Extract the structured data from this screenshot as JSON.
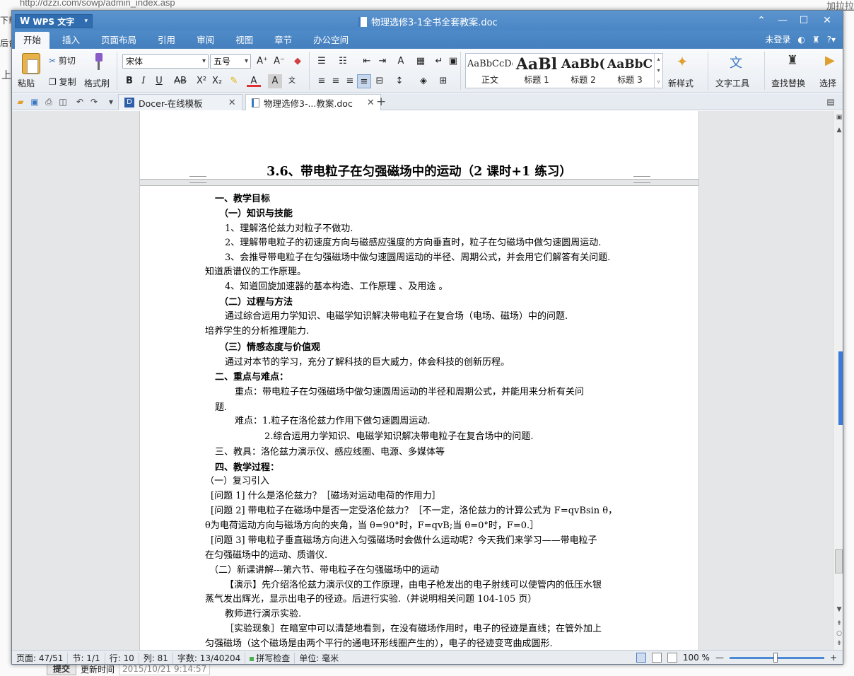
{
  "background": {
    "url": "http://dzzi.com/sowp/admin_index.asp",
    "left_text_1": "下载",
    "left_text_2": "后台",
    "left_text_3": "上",
    "right_link": "加拉拉",
    "submit_label": "提交",
    "update_label": "更新时间",
    "update_time": "2015/10/21 9:14:57"
  },
  "window": {
    "app_name": "WPS 文字",
    "doc_title": "物理选修3-1全书全套教案.doc",
    "controls": {
      "collapse": "⌃",
      "minimize": "—",
      "maximize": "☐",
      "close": "✕"
    }
  },
  "menu": {
    "tabs": [
      "开始",
      "插入",
      "页面布局",
      "引用",
      "审阅",
      "视图",
      "章节",
      "办公空间"
    ],
    "active": "开始",
    "login": "未登录"
  },
  "ribbon": {
    "paste": "粘贴",
    "cut": "剪切",
    "copy": "复制",
    "format_painter": "格式刷",
    "font_name": "宋体",
    "font_size": "五号",
    "grow": "A⁺",
    "shrink": "A⁻",
    "bold": "B",
    "italic": "I",
    "underline": "U",
    "strike": "AB",
    "superscript": "X²",
    "subscript": "X₂",
    "styles": [
      {
        "sample": "AaBbCcDd",
        "name": "正文"
      },
      {
        "sample": "AaBl",
        "name": "标题 1"
      },
      {
        "sample": "AaBb(",
        "name": "标题 2"
      },
      {
        "sample": "AaBbC",
        "name": "标题 3"
      }
    ],
    "new_style": "新样式",
    "text_tools": "文字工具",
    "find_replace": "查找替换",
    "select": "选择"
  },
  "tabs": [
    {
      "label": "Docer-在线模板",
      "close": "✕"
    },
    {
      "label": "物理选修3-...教案.doc",
      "close": "✕"
    }
  ],
  "tab_add": "+",
  "document": {
    "heading": "3.6、带电粒子在匀强磁场中的运动（2 课时+1 练习）",
    "lines": [
      {
        "text": "一、教学目标",
        "bold": true
      },
      {
        "text": "（一）知识与技能",
        "bold": true
      },
      {
        "text": "1、理解洛伦兹力对粒子不做功.",
        "bold": false
      },
      {
        "text": "2、理解带电粒子的初速度方向与磁感应强度的方向垂直时，粒子在匀磁场中做匀速圆周运动.",
        "bold": false
      },
      {
        "text": "3、会推导带电粒子在匀强磁场中做匀速圆周运动的半径、周期公式，并会用它们解答有关问题.",
        "bold": false
      },
      {
        "text": "知道质谱仪的工作原理。",
        "bold": false
      },
      {
        "text": "4、知道回旋加速器的基本构造、工作原理 、及用途 。",
        "bold": false
      },
      {
        "text": "（二）过程与方法",
        "bold": true
      },
      {
        "text": "通过综合运用力学知识、电磁学知识解决带电粒子在复合场（电场、磁场）中的问题.",
        "bold": false
      },
      {
        "text": "培养学生的分析推理能力.",
        "bold": false
      },
      {
        "text": "（三）情感态度与价值观",
        "bold": true
      },
      {
        "text": "通过对本节的学习，充分了解科技的巨大威力，体会科技的创新历程。",
        "bold": false
      },
      {
        "text": "二、重点与难点：",
        "bold": true
      },
      {
        "text": "重点：带电粒子在匀强磁场中做匀速圆周运动的半径和周期公式，并能用来分析有关问",
        "bold": false
      },
      {
        "text": "题.",
        "bold": false
      },
      {
        "text": "难点：1.粒子在洛伦兹力作用下做匀速圆周运动.",
        "bold": false
      },
      {
        "text": "2.综合运用力学知识、电磁学知识解决带电粒子在复合场中的问题.",
        "bold": false
      },
      {
        "text": "三、教具：洛伦兹力演示仪、感应线圈、电源、多媒体等",
        "bold": false
      },
      {
        "text": "四、教学过程：",
        "bold": true
      },
      {
        "text": "（一）复习引入",
        "bold": false
      },
      {
        "text": "[问题 1] 什么是洛伦兹力？［磁场对运动电荷的作用力］",
        "bold": false
      },
      {
        "text": "[问题 2] 带电粒子在磁场中是否一定受洛伦兹力？［不一定，洛伦兹力的计算公式为 F=qvBsin θ，",
        "bold": false
      },
      {
        "text": "θ为电荷运动方向与磁场方向的夹角，当 θ=90°时，F=qvB;当 θ=0°时，F=0.］",
        "bold": false
      },
      {
        "text": "[问题 3] 带电粒子垂直磁场方向进入匀强磁场时会做什么运动呢？今天我们来学习——带电粒子",
        "bold": false
      },
      {
        "text": "在匀强磁场中的运动、质谱仪.",
        "bold": false
      },
      {
        "text": "（二）新课讲解---第六节、带电粒子在匀强磁场中的运动",
        "bold": false
      },
      {
        "text": "【演示】先介绍洛伦兹力演示仪的工作原理，由电子枪发出的电子射线可以使管内的低压水银",
        "bold": false
      },
      {
        "text": "蒸气发出辉光，显示出电子的径迹。后进行实验.（并说明相关问题 104-105 页）",
        "bold": false
      },
      {
        "text": "教师进行演示实验.",
        "bold": false
      },
      {
        "text": "［实验现象］在暗室中可以清楚地看到，在没有磁场作用时，电子的径迹是直线；在管外加上",
        "bold": false
      },
      {
        "text": "匀强磁场（这个磁场是由两个平行的通电环形线圈产生的），电子的径迹变弯曲成圆形.",
        "bold": false
      }
    ]
  },
  "status": {
    "page": "页面: 47/51",
    "section": "节: 1/1",
    "row": "行: 10",
    "col": "列: 81",
    "words": "字数: 13/40204",
    "spell": "拼写检查",
    "unit": "单位: 毫米",
    "zoom": "100 %",
    "zoom_minus": "—",
    "zoom_plus": "+"
  },
  "colors": {
    "titlebar": "#4a86c5",
    "accent": "#3a7bd5"
  }
}
